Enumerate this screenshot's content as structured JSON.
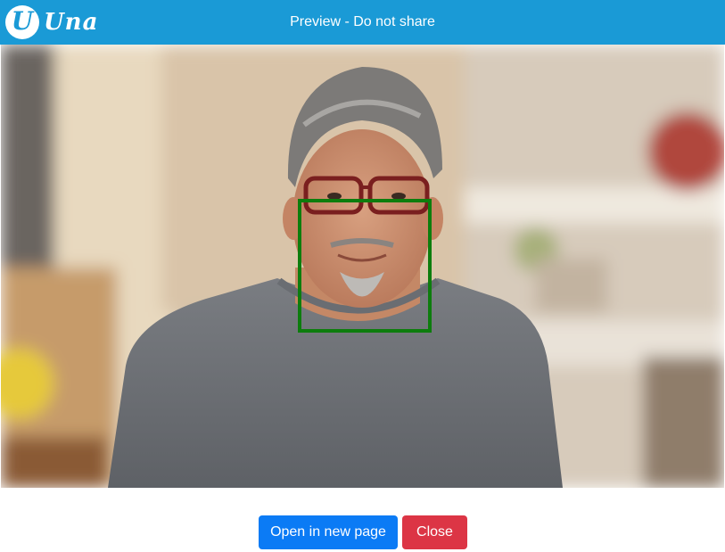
{
  "header": {
    "logo_text": "Una",
    "logo_letter": "U",
    "title": "Preview - Do not share"
  },
  "image": {
    "description_icon": "portrait-photo",
    "detection_box_color": "#0d7d0d"
  },
  "footer": {
    "open_button_label": "Open in new page",
    "close_button_label": "Close"
  },
  "colors": {
    "header_bg": "#1a9ad6",
    "open_button": "#0b7bf5",
    "close_button": "#dc3545"
  }
}
